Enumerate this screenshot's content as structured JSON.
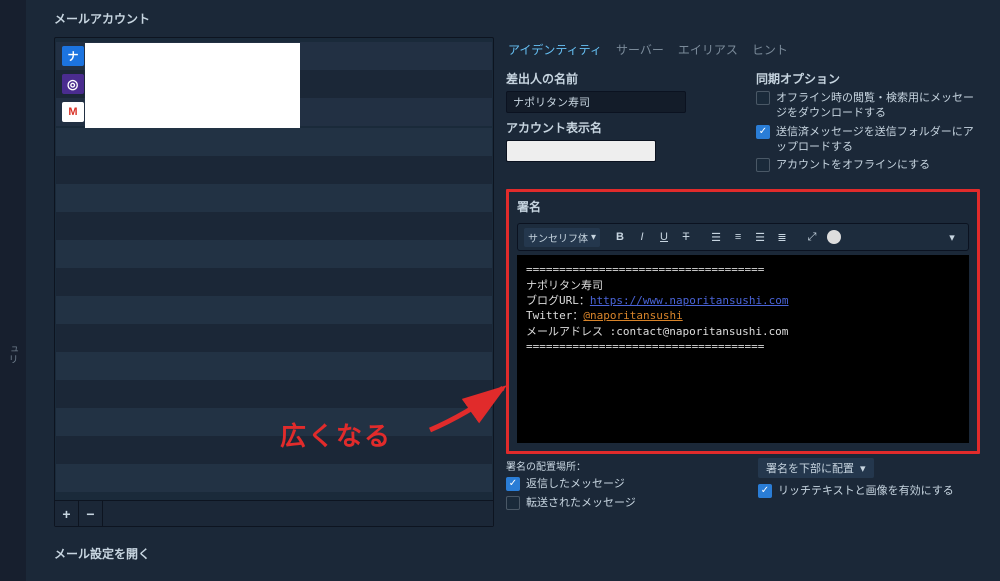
{
  "section_title": "メールアカウント",
  "left_rail_label": "ュリ",
  "accounts": {
    "icon1": "ナ",
    "icon2": "◎",
    "icon3": "M",
    "add": "+",
    "remove": "−"
  },
  "tabs": {
    "identity": "アイデンティティ",
    "servers": "サーバー",
    "aliases": "エイリアス",
    "hints": "ヒント"
  },
  "identity": {
    "sender_name_label": "差出人の名前",
    "sender_name_value": "ナポリタン寿司",
    "account_display_label": "アカウント表示名",
    "account_display_value": ""
  },
  "sync": {
    "title": "同期オプション",
    "opt1": "オフライン時の閲覧・検索用にメッセージをダウンロードする",
    "opt2": "送信済メッセージを送信フォルダーにアップロードする",
    "opt3": "アカウントをオフラインにする"
  },
  "signature": {
    "label": "署名",
    "font_select": "サンセリフ体",
    "divider": "====================================",
    "line1": "ナポリタン寿司",
    "line2a": "ブログURL：",
    "line2b": "https://www.naporitansushi.com",
    "line3a": "Twitter：",
    "line3b": "@naporitansushi",
    "line4": "メールアドレス :contact@naporitansushi.com"
  },
  "placement": {
    "label": "署名の配置場所：",
    "opt1": "返信したメッセージ",
    "opt2": "転送されたメッセージ",
    "position_select": "署名を下部に配置",
    "richtext": "リッチテキストと画像を有効にする"
  },
  "open_settings": "メール設定を開く",
  "annotation": "広くなる"
}
